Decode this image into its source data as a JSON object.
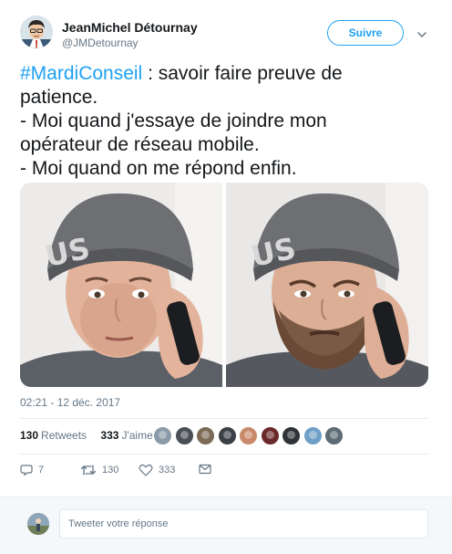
{
  "author": {
    "name": "JeanMichel Détournay",
    "handle": "@JMDetournay",
    "avatar_icon": "user-avatar-cartoon"
  },
  "follow_button": {
    "label": "Suivre"
  },
  "menu_icon": "chevron-down-icon",
  "tweet": {
    "hashtag": "#MardiConseil",
    "line1_rest": " : savoir faire preuve de",
    "line2": "patience.",
    "line3": "- Moi quand j'essaye de joindre mon",
    "line4": "opérateur de réseau mobile.",
    "line5": "- Moi quand on me répond enfin."
  },
  "media": {
    "photos": [
      {
        "name": "photo-clean-shaven",
        "description_icon": "man-with-beanie-on-phone"
      },
      {
        "name": "photo-bearded",
        "description_icon": "man-with-beard-and-beanie-on-phone"
      }
    ]
  },
  "timestamp": "02:21 - 12 déc. 2017",
  "stats": {
    "retweets_count": "130",
    "retweets_label": "Retweets",
    "likes_count": "333",
    "likes_label": "J'aime"
  },
  "likers": [
    {
      "color": "#8a9aa8"
    },
    {
      "color": "#4a4f55"
    },
    {
      "color": "#7c6a55"
    },
    {
      "color": "#3b3f46"
    },
    {
      "color": "#c98a6b"
    },
    {
      "color": "#6b2a2a"
    },
    {
      "color": "#2f3338"
    },
    {
      "color": "#6fa0c8"
    },
    {
      "color": "#5d6b74"
    }
  ],
  "actions": {
    "reply_count": "7",
    "retweet_count": "130",
    "like_count": "333"
  },
  "reply": {
    "placeholder": "Tweeter votre réponse"
  },
  "colors": {
    "accent": "#1da1f2",
    "text": "#14171a",
    "secondary": "#657786"
  }
}
